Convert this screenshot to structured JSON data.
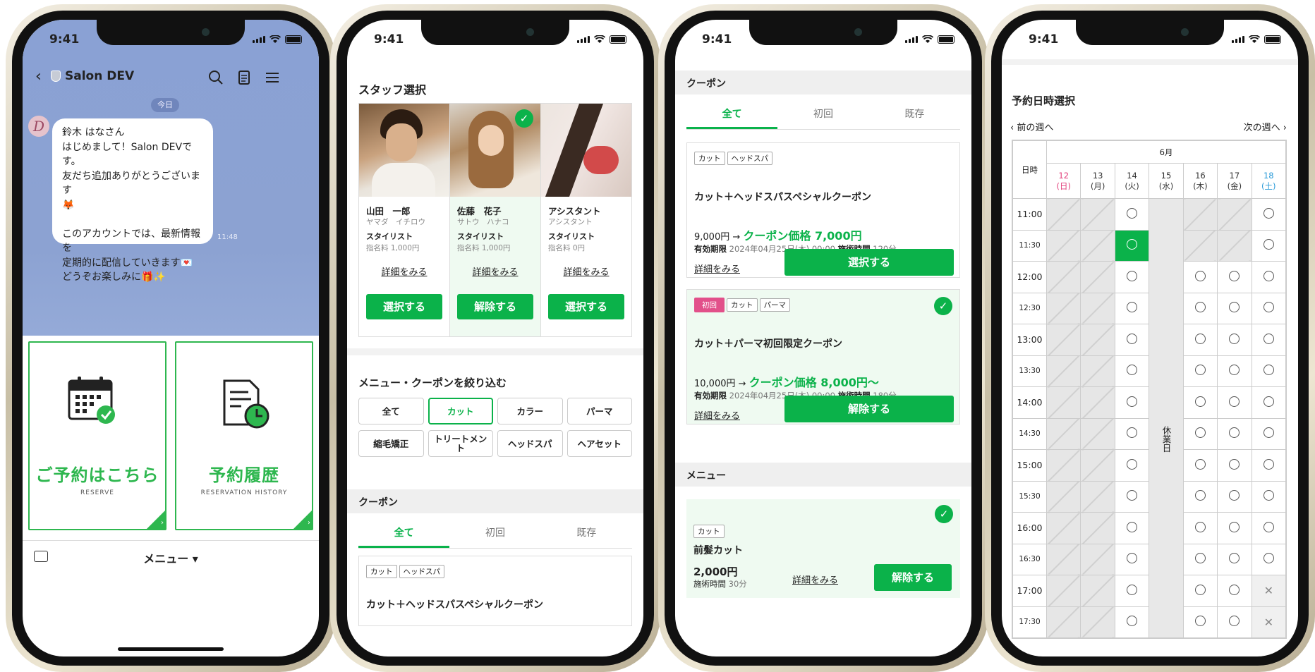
{
  "status_time": "9:41",
  "p1": {
    "title": "Salon DEV",
    "today": "今日",
    "avatar_letter": "D",
    "message": "鈴木 はなさん\nはじめまして！Salon DEVです。\n友だち追加ありがとうございます\n🦊\n\nこのアカウントでは、最新情報を\n定期的に配信していきます💌\nどうぞお楽しみに🎁✨",
    "msg_time": "11:48",
    "reserve_label": "ご予約はこちら",
    "reserve_sub": "RESERVE",
    "history_label": "予約履歴",
    "history_sub": "RESERVATION HISTORY",
    "menu_label": "メニュー ▾"
  },
  "p2": {
    "staff_title": "スタッフ選択",
    "staff": [
      {
        "name": "山田　一郎",
        "kana": "ヤマダ　イチロウ",
        "role": "スタイリスト",
        "fee_label": "指名料",
        "fee": "1,000円",
        "detail": "詳細をみる",
        "action": "選択する"
      },
      {
        "name": "佐藤　花子",
        "kana": "サトウ　ハナコ",
        "role": "スタイリスト",
        "fee_label": "指名料",
        "fee": "1,000円",
        "detail": "詳細をみる",
        "action": "解除する"
      },
      {
        "name": "アシスタント",
        "kana": "アシスタント",
        "role": "スタイリスト",
        "fee_label": "指名料",
        "fee": "0円",
        "detail": "詳細をみる",
        "action": "選択する"
      }
    ],
    "filter_title": "メニュー・クーポンを絞り込む",
    "filters": [
      "全て",
      "カット",
      "カラー",
      "パーマ",
      "縮毛矯正",
      "トリートメント",
      "ヘッドスパ",
      "ヘアセット"
    ],
    "coupon_band": "クーポン",
    "tabs": [
      "全て",
      "初回",
      "既存"
    ],
    "coupon_tags": [
      "カット",
      "ヘッドスパ"
    ],
    "coupon_name": "カット＋ヘッドスパスペシャルクーポン"
  },
  "p3": {
    "coupon_band": "クーポン",
    "tabs": [
      "全て",
      "初回",
      "既存"
    ],
    "coupons": [
      {
        "tags": [
          "カット",
          "ヘッドスパ"
        ],
        "name": "カット＋ヘッドスパスペシャルクーポン",
        "price": "9,000円 →",
        "coupon_price": "クーポン価格 7,000円",
        "valid_label": "有効期限",
        "valid": "2024年04月25日(木) 00:00",
        "time_label": "施術時間",
        "time": "120分",
        "detail": "詳細をみる",
        "action": "選択する"
      },
      {
        "badge": "初回",
        "tags": [
          "カット",
          "パーマ"
        ],
        "name": "カット＋パーマ初回限定クーポン",
        "price": "10,000円 →",
        "coupon_price": "クーポン価格 8,000円〜",
        "valid_label": "有効期限",
        "valid": "2024年04月25日(木) 00:00",
        "time_label": "施術時間",
        "time": "180分",
        "detail": "詳細をみる",
        "action": "解除する"
      }
    ],
    "menu_band": "メニュー",
    "menu_item": {
      "tag": "カット",
      "name": "前髪カット",
      "price": "2,000円",
      "time_label": "施術時間",
      "time": "30分",
      "detail": "詳細をみる",
      "action": "解除する"
    }
  },
  "p4": {
    "title": "予約日時選択",
    "prev": "‹ 前の週へ",
    "next": "次の週へ ›",
    "month": "6月",
    "corner": "日時",
    "days": [
      {
        "d": "12",
        "w": "(日)",
        "color": "#e2407c"
      },
      {
        "d": "13",
        "w": "(月)",
        "color": "#333"
      },
      {
        "d": "14",
        "w": "(火)",
        "color": "#333"
      },
      {
        "d": "15",
        "w": "(水)",
        "color": "#333"
      },
      {
        "d": "16",
        "w": "(木)",
        "color": "#333"
      },
      {
        "d": "17",
        "w": "(金)",
        "color": "#333"
      },
      {
        "d": "18",
        "w": "(土)",
        "color": "#2a9ad8"
      }
    ],
    "holiday": "休業日",
    "times": [
      "11:00",
      "11:30",
      "12:00",
      "12:30",
      "13:00",
      "13:30",
      "14:00",
      "14:30",
      "15:00",
      "15:30",
      "16:00",
      "16:30",
      "17:00",
      "17:30"
    ],
    "grid": [
      [
        "g",
        "g",
        "o",
        "h",
        "g",
        "g",
        "o"
      ],
      [
        "g",
        "g",
        "s",
        "h",
        "g",
        "g",
        "o"
      ],
      [
        "g",
        "g",
        "o",
        "h",
        "o",
        "o",
        "o"
      ],
      [
        "g",
        "g",
        "o",
        "h",
        "o",
        "o",
        "o"
      ],
      [
        "g",
        "g",
        "o",
        "h",
        "o",
        "o",
        "o"
      ],
      [
        "g",
        "g",
        "o",
        "h",
        "o",
        "o",
        "o"
      ],
      [
        "g",
        "g",
        "o",
        "h",
        "o",
        "o",
        "o"
      ],
      [
        "g",
        "g",
        "o",
        "h",
        "o",
        "o",
        "o"
      ],
      [
        "g",
        "g",
        "o",
        "h",
        "o",
        "o",
        "o"
      ],
      [
        "g",
        "g",
        "o",
        "h",
        "o",
        "o",
        "o"
      ],
      [
        "g",
        "g",
        "o",
        "h",
        "o",
        "o",
        "o"
      ],
      [
        "g",
        "g",
        "o",
        "h",
        "o",
        "o",
        "o"
      ],
      [
        "g",
        "g",
        "o",
        "h",
        "o",
        "o",
        "x"
      ],
      [
        "g",
        "g",
        "o",
        "h",
        "o",
        "o",
        "x"
      ]
    ]
  }
}
